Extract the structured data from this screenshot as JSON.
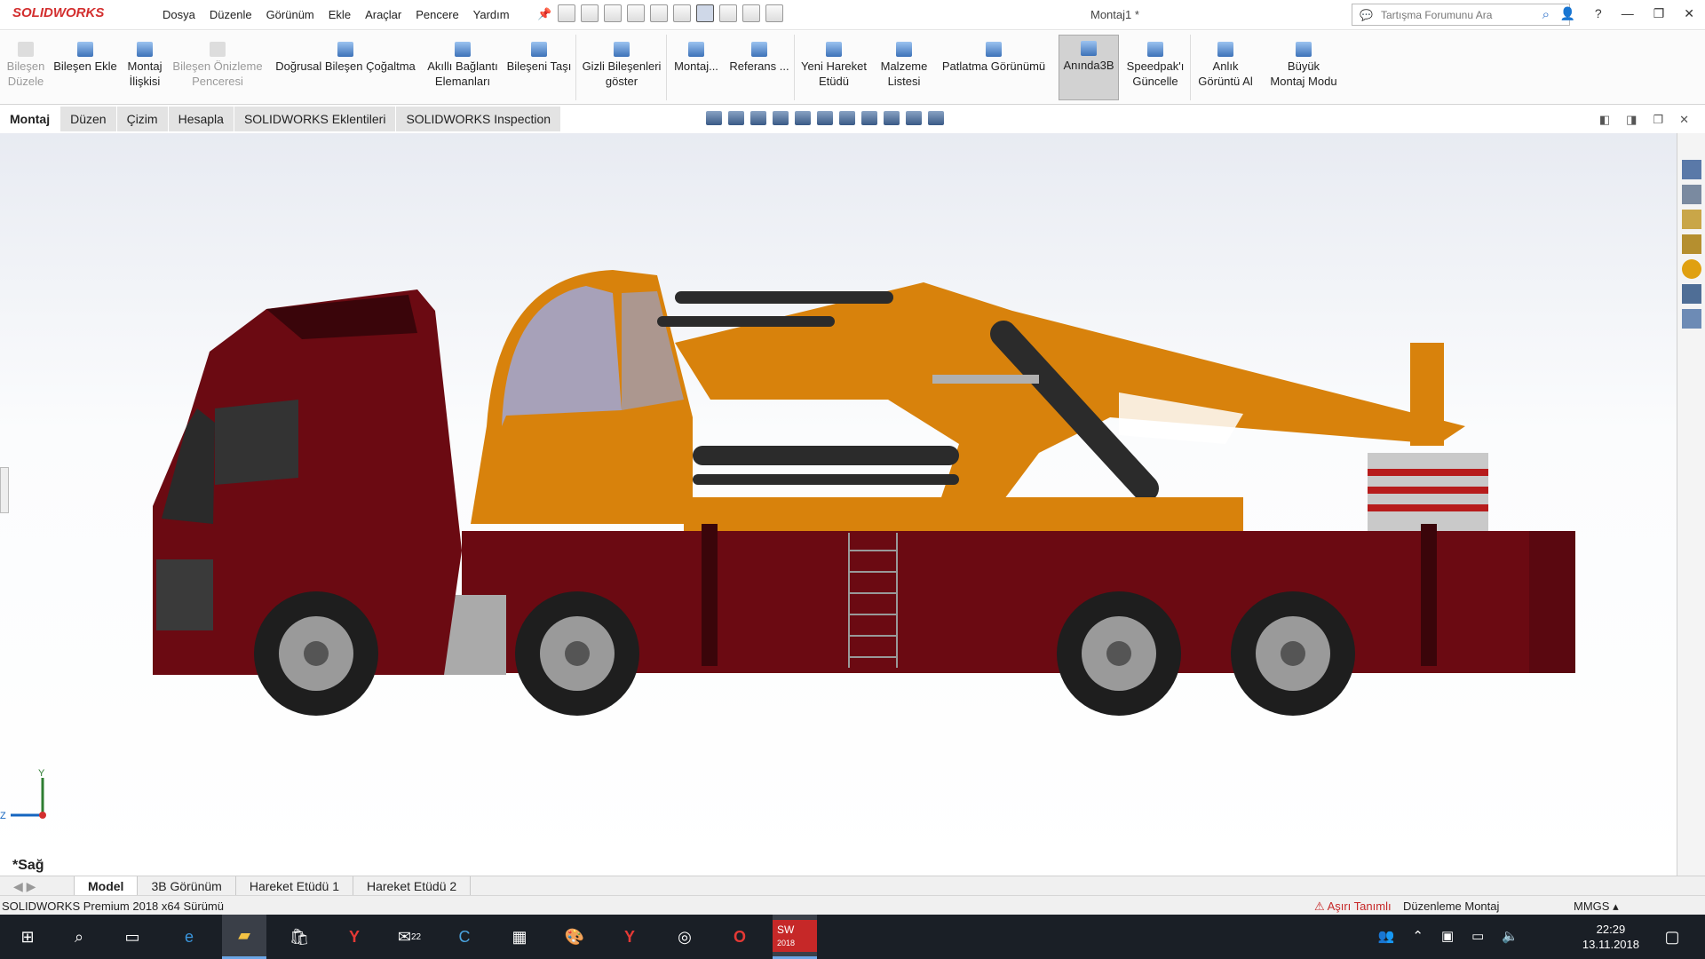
{
  "app": {
    "brand": "SOLIDWORKS",
    "doc_title": "Montaj1 *"
  },
  "menu": [
    "Dosya",
    "Düzenle",
    "Görünüm",
    "Ekle",
    "Araçlar",
    "Pencere",
    "Yardım"
  ],
  "search": {
    "placeholder": "Tartışma Forumunu Ara"
  },
  "toolbar": {
    "edit_component": [
      "Bileşen",
      "Düzele"
    ],
    "add_component": "Bileşen Ekle",
    "mate": [
      "Montaj",
      "İlişkisi"
    ],
    "preview": [
      "Bileşen Önizleme",
      "Penceresi"
    ],
    "pattern": "Doğrusal Bileşen Çoğaltma",
    "smart_fasteners": [
      "Akıllı Bağlantı",
      "Elemanları"
    ],
    "move_component": "Bileşeni Taşı",
    "show_hidden": [
      "Gizli Bileşenleri",
      "göster"
    ],
    "assembly": "Montaj...",
    "reference": "Referans ...",
    "motion_study": [
      "Yeni Hareket",
      "Etüdü"
    ],
    "bom": [
      "Malzeme",
      "Listesi"
    ],
    "explode": "Patlatma Görünümü",
    "instant3d": "Anında3B",
    "speedpak": [
      "Speedpak'ı",
      "Güncelle"
    ],
    "snapshot": [
      "Anlık",
      "Görüntü Al"
    ],
    "large_mode": [
      "Büyük",
      "Montaj Modu"
    ]
  },
  "tabs": [
    "Montaj",
    "Düzen",
    "Çizim",
    "Hesapla",
    "SOLIDWORKS Eklentileri",
    "SOLIDWORKS Inspection"
  ],
  "triad": {
    "y": "Y",
    "z": "Z"
  },
  "view_label": "*Sağ",
  "bottom_tabs": [
    "Model",
    "3B Görünüm",
    "Hareket Etüdü 1",
    "Hareket Etüdü 2"
  ],
  "status": {
    "version": "SOLIDWORKS Premium 2018 x64 Sürümü",
    "warning": "Aşırı Tanımlı",
    "mode": "Düzenleme Montaj",
    "units": "MMGS"
  },
  "taskbar": {
    "time": "22:29",
    "date": "13.11.2018",
    "mail_count": "22",
    "sw_label": "2018"
  },
  "colors": {
    "truck_body": "#6b0a12",
    "crane": "#d8820c",
    "accent_red": "#d32f2f"
  }
}
